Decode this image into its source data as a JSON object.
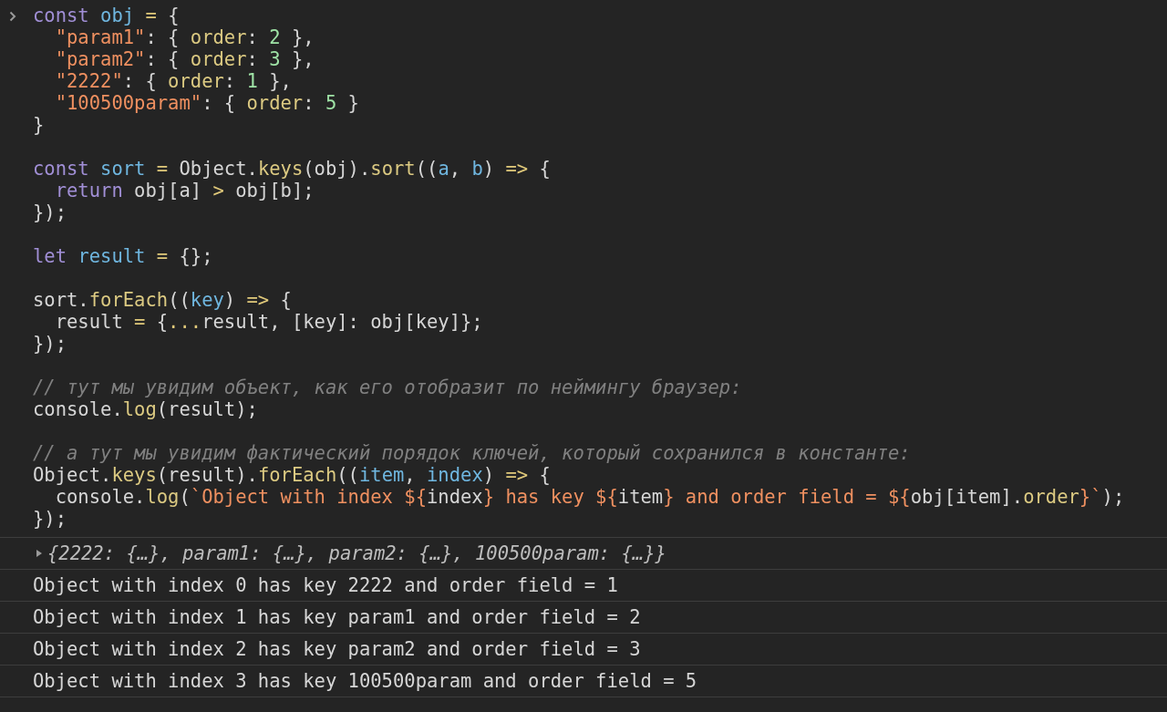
{
  "input": {
    "lines": [
      {
        "kind": "code",
        "indented": false,
        "tokens": [
          {
            "t": "const ",
            "kind": "kw"
          },
          {
            "t": "obj ",
            "kind": "def"
          },
          {
            "t": "= ",
            "kind": "op"
          },
          {
            "t": "{",
            "kind": "txt"
          }
        ]
      },
      {
        "kind": "code",
        "indented": true,
        "tokens": [
          {
            "t": "\"param1\"",
            "kind": "str"
          },
          {
            "t": ": { ",
            "kind": "txt"
          },
          {
            "t": "order",
            "kind": "prop"
          },
          {
            "t": ": ",
            "kind": "txt"
          },
          {
            "t": "2",
            "kind": "num"
          },
          {
            "t": " },",
            "kind": "txt"
          }
        ]
      },
      {
        "kind": "code",
        "indented": true,
        "tokens": [
          {
            "t": "\"param2\"",
            "kind": "str"
          },
          {
            "t": ": { ",
            "kind": "txt"
          },
          {
            "t": "order",
            "kind": "prop"
          },
          {
            "t": ": ",
            "kind": "txt"
          },
          {
            "t": "3",
            "kind": "num"
          },
          {
            "t": " },",
            "kind": "txt"
          }
        ]
      },
      {
        "kind": "code",
        "indented": true,
        "tokens": [
          {
            "t": "\"2222\"",
            "kind": "str"
          },
          {
            "t": ": { ",
            "kind": "txt"
          },
          {
            "t": "order",
            "kind": "prop"
          },
          {
            "t": ": ",
            "kind": "txt"
          },
          {
            "t": "1",
            "kind": "num"
          },
          {
            "t": " },",
            "kind": "txt"
          }
        ]
      },
      {
        "kind": "code",
        "indented": true,
        "tokens": [
          {
            "t": "\"100500param\"",
            "kind": "str"
          },
          {
            "t": ": { ",
            "kind": "txt"
          },
          {
            "t": "order",
            "kind": "prop"
          },
          {
            "t": ": ",
            "kind": "txt"
          },
          {
            "t": "5",
            "kind": "num"
          },
          {
            "t": " }",
            "kind": "txt"
          }
        ]
      },
      {
        "kind": "code",
        "indented": false,
        "tokens": [
          {
            "t": "}",
            "kind": "txt"
          }
        ]
      },
      {
        "kind": "blank"
      },
      {
        "kind": "code",
        "indented": false,
        "tokens": [
          {
            "t": "const ",
            "kind": "kw"
          },
          {
            "t": "sort ",
            "kind": "def"
          },
          {
            "t": "= ",
            "kind": "op"
          },
          {
            "t": "Object.",
            "kind": "txt"
          },
          {
            "t": "keys",
            "kind": "prop"
          },
          {
            "t": "(obj).",
            "kind": "txt"
          },
          {
            "t": "sort",
            "kind": "prop"
          },
          {
            "t": "((",
            "kind": "txt"
          },
          {
            "t": "a",
            "kind": "def"
          },
          {
            "t": ", ",
            "kind": "txt"
          },
          {
            "t": "b",
            "kind": "def"
          },
          {
            "t": ") ",
            "kind": "txt"
          },
          {
            "t": "=>",
            "kind": "op"
          },
          {
            "t": " {",
            "kind": "txt"
          }
        ]
      },
      {
        "kind": "code",
        "indented": true,
        "tokens": [
          {
            "t": "return",
            "kind": "kw"
          },
          {
            "t": " obj[a] ",
            "kind": "txt"
          },
          {
            "t": ">",
            "kind": "op"
          },
          {
            "t": " obj[b];",
            "kind": "txt"
          }
        ]
      },
      {
        "kind": "code",
        "indented": false,
        "tokens": [
          {
            "t": "});",
            "kind": "txt"
          }
        ]
      },
      {
        "kind": "blank"
      },
      {
        "kind": "code",
        "indented": false,
        "tokens": [
          {
            "t": "let ",
            "kind": "kw"
          },
          {
            "t": "result ",
            "kind": "def"
          },
          {
            "t": "= ",
            "kind": "op"
          },
          {
            "t": "{};",
            "kind": "txt"
          }
        ]
      },
      {
        "kind": "blank"
      },
      {
        "kind": "code",
        "indented": false,
        "tokens": [
          {
            "t": "sort.",
            "kind": "txt"
          },
          {
            "t": "forEach",
            "kind": "prop"
          },
          {
            "t": "((",
            "kind": "txt"
          },
          {
            "t": "key",
            "kind": "def"
          },
          {
            "t": ") ",
            "kind": "txt"
          },
          {
            "t": "=>",
            "kind": "op"
          },
          {
            "t": " {",
            "kind": "txt"
          }
        ]
      },
      {
        "kind": "code",
        "indented": true,
        "tokens": [
          {
            "t": "result ",
            "kind": "txt"
          },
          {
            "t": "=",
            "kind": "op"
          },
          {
            "t": " {",
            "kind": "txt"
          },
          {
            "t": "...",
            "kind": "op"
          },
          {
            "t": "result, [key]: obj[key]};",
            "kind": "txt"
          }
        ]
      },
      {
        "kind": "code",
        "indented": false,
        "tokens": [
          {
            "t": "});",
            "kind": "txt"
          }
        ]
      },
      {
        "kind": "blank"
      },
      {
        "kind": "code",
        "indented": false,
        "tokens": [
          {
            "t": "// тут мы увидим объект, как его отобразит по неймингу браузер:",
            "kind": "cmt"
          }
        ]
      },
      {
        "kind": "code",
        "indented": false,
        "tokens": [
          {
            "t": "console.",
            "kind": "txt"
          },
          {
            "t": "log",
            "kind": "prop"
          },
          {
            "t": "(result);",
            "kind": "txt"
          }
        ]
      },
      {
        "kind": "blank"
      },
      {
        "kind": "code",
        "indented": false,
        "tokens": [
          {
            "t": "// а тут мы увидим фактический порядок ключей, который сохранился в константе:",
            "kind": "cmt"
          }
        ]
      },
      {
        "kind": "code",
        "indented": false,
        "tokens": [
          {
            "t": "Object.",
            "kind": "txt"
          },
          {
            "t": "keys",
            "kind": "prop"
          },
          {
            "t": "(result).",
            "kind": "txt"
          },
          {
            "t": "forEach",
            "kind": "prop"
          },
          {
            "t": "((",
            "kind": "txt"
          },
          {
            "t": "item",
            "kind": "def"
          },
          {
            "t": ", ",
            "kind": "txt"
          },
          {
            "t": "index",
            "kind": "def"
          },
          {
            "t": ") ",
            "kind": "txt"
          },
          {
            "t": "=>",
            "kind": "op"
          },
          {
            "t": " {",
            "kind": "txt"
          }
        ]
      },
      {
        "kind": "code",
        "indented": true,
        "tokens": [
          {
            "t": "console.",
            "kind": "txt"
          },
          {
            "t": "log",
            "kind": "prop"
          },
          {
            "t": "(",
            "kind": "txt"
          },
          {
            "t": "`Object with index ${",
            "kind": "str"
          },
          {
            "t": "index",
            "kind": "txt"
          },
          {
            "t": "} has key ${",
            "kind": "str"
          },
          {
            "t": "item",
            "kind": "txt"
          },
          {
            "t": "} and order field = ${",
            "kind": "str"
          },
          {
            "t": "obj[item].",
            "kind": "txt"
          },
          {
            "t": "order",
            "kind": "prop"
          },
          {
            "t": "}`",
            "kind": "str"
          },
          {
            "t": ");",
            "kind": "txt"
          }
        ]
      },
      {
        "kind": "code",
        "indented": false,
        "tokens": [
          {
            "t": "});",
            "kind": "txt"
          }
        ]
      }
    ]
  },
  "output": [
    {
      "kind": "object",
      "text": "{2222: {…}, param1: {…}, param2: {…}, 100500param: {…}}",
      "expanded": false
    },
    {
      "kind": "log",
      "text": "Object with index 0 has key 2222 and order field = 1"
    },
    {
      "kind": "log",
      "text": "Object with index 1 has key param1 and order field = 2"
    },
    {
      "kind": "log",
      "text": "Object with index 2 has key param2 and order field = 3"
    },
    {
      "kind": "log",
      "text": "Object with index 3 has key 100500param and order field = 5"
    }
  ]
}
